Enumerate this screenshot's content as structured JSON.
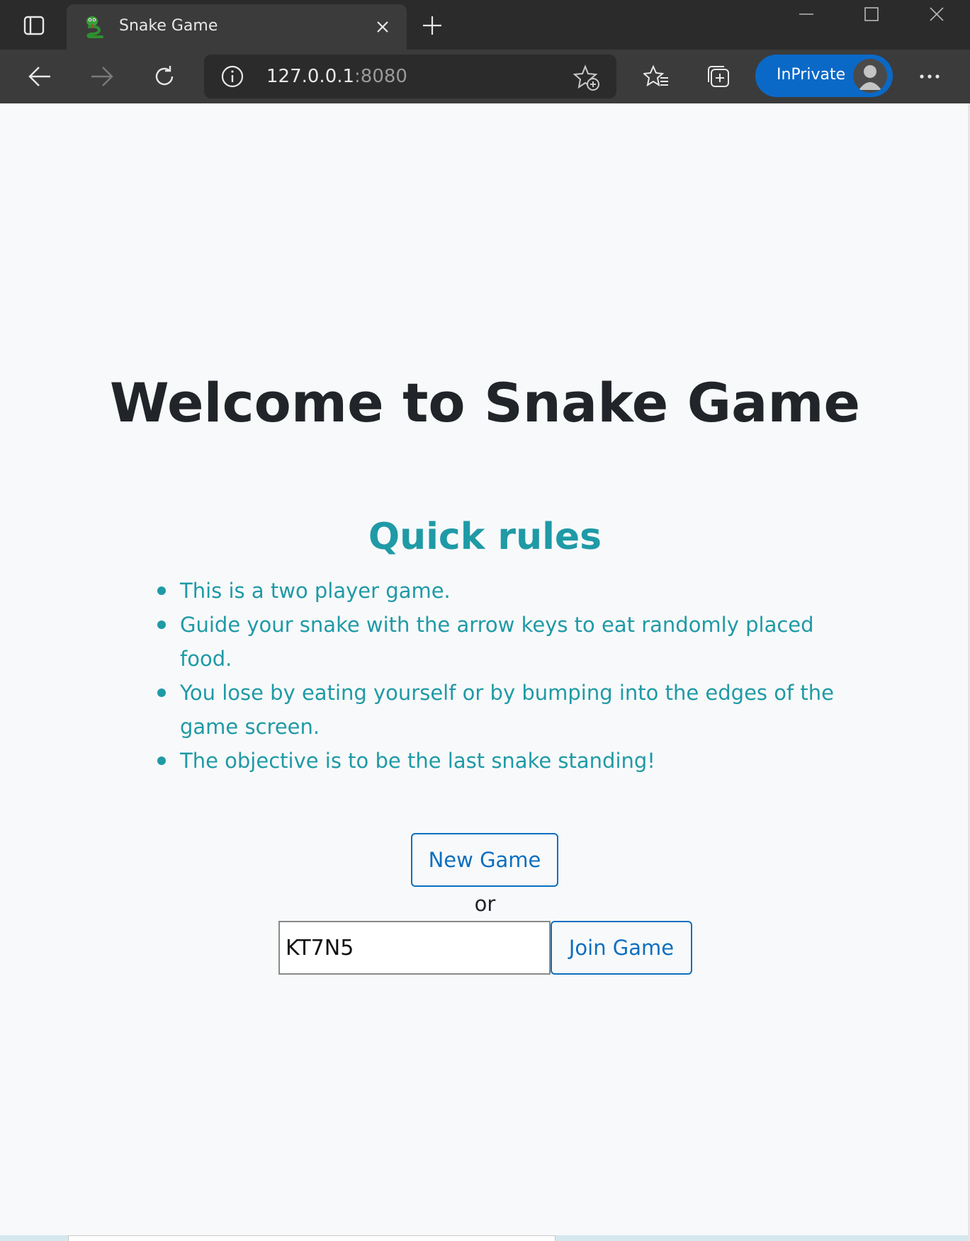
{
  "browser": {
    "tab": {
      "title": "Snake Game",
      "favicon": "snake-icon"
    },
    "address": {
      "host": "127.0.0.1",
      "port": ":8080"
    },
    "inprivate_label": "InPrivate",
    "icons": {
      "tab_actions": "tab-actions-icon",
      "close_tab": "close-icon",
      "new_tab": "plus-icon",
      "back": "arrow-left-icon",
      "forward": "arrow-right-icon",
      "refresh": "refresh-icon",
      "site_info": "info-icon",
      "add_favorite": "star-plus-icon",
      "favorites": "favorites-icon",
      "collections": "collections-icon",
      "more": "more-icon"
    },
    "colors": {
      "tabstrip": "#2b2b2b",
      "toolbar": "#3b3b3b",
      "inprivate": "#0a69c7"
    }
  },
  "page": {
    "title": "Welcome to Snake Game",
    "rules_heading": "Quick rules",
    "rules": [
      "This is a two player game.",
      "Guide your snake with the arrow keys to eat randomly placed food.",
      "You lose by eating yourself or by bumping into the edges of the game screen.",
      "The objective is to be the last snake standing!"
    ],
    "new_game_label": "New Game",
    "or_label": "or",
    "game_code_value": "KT7N5",
    "join_game_label": "Join Game",
    "colors": {
      "heading": "#212529",
      "rules": "#1f9aa6",
      "button": "#0d6fbf",
      "background": "#f8f9fa"
    }
  }
}
